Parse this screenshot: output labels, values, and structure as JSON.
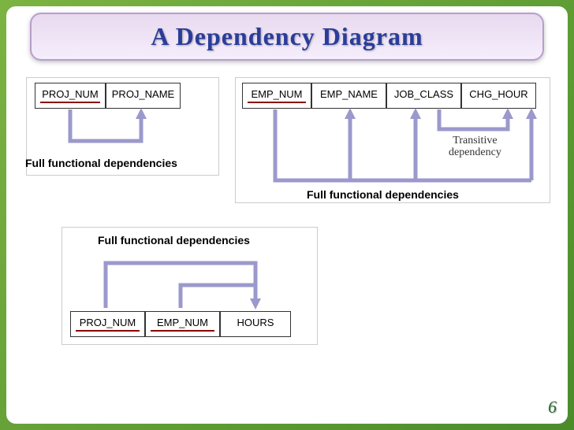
{
  "title": "A Dependency Diagram",
  "page_number": "6",
  "labels": {
    "full_functional": "Full functional dependencies",
    "transitive": "Transitive\ndependency"
  },
  "diagram1": {
    "cells": [
      {
        "text": "PROJ_NUM",
        "key": true
      },
      {
        "text": "PROJ_NAME",
        "key": false
      }
    ]
  },
  "diagram2": {
    "cells": [
      {
        "text": "EMP_NUM",
        "key": true
      },
      {
        "text": "EMP_NAME",
        "key": false
      },
      {
        "text": "JOB_CLASS",
        "key": false
      },
      {
        "text": "CHG_HOUR",
        "key": false
      }
    ]
  },
  "diagram3": {
    "cells": [
      {
        "text": "PROJ_NUM",
        "key": true
      },
      {
        "text": "EMP_NUM",
        "key": true
      },
      {
        "text": "HOURS",
        "key": false
      }
    ]
  }
}
